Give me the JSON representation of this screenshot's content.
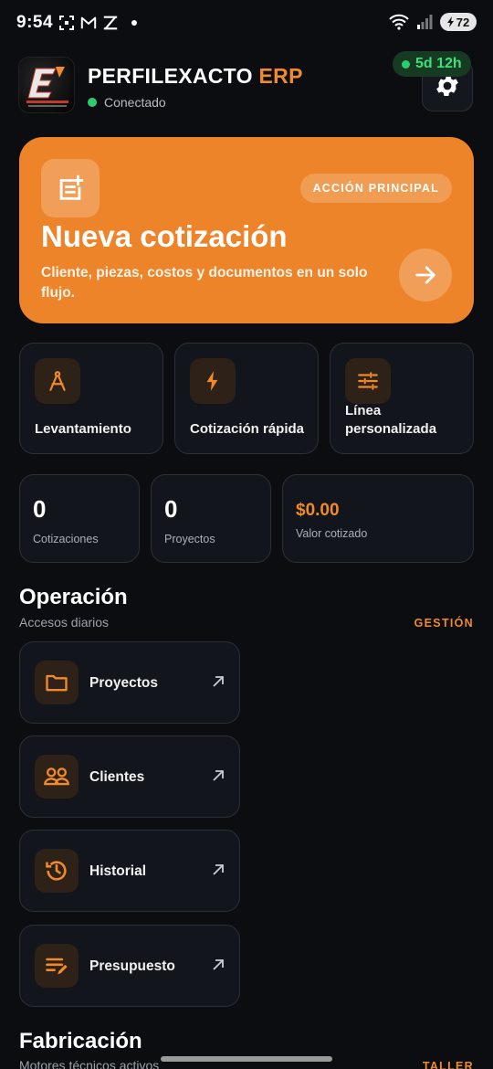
{
  "status_bar": {
    "time": "9:54",
    "battery": "72",
    "icons_left": [
      "scan-icon",
      "gmail-icon",
      "bolt-app-icon",
      "notification-dot"
    ],
    "icons_right": [
      "wifi-icon",
      "signal-icon",
      "battery-icon"
    ]
  },
  "header": {
    "brand_main": "PERFILEXACTO",
    "brand_suffix": "ERP",
    "status": "Conectado",
    "uptime": "5d 12h",
    "settings_icon": "gear-icon"
  },
  "hero": {
    "badge": "ACCIÓN PRINCIPAL",
    "title": "Nueva cotización",
    "subtitle": "Cliente, piezas, costos y documentos en un solo flujo.",
    "icon": "new-document-icon",
    "arrow_icon": "arrow-right-icon"
  },
  "quick_actions": [
    {
      "label": "Levantamiento",
      "icon": "compass-icon"
    },
    {
      "label": "Cotización rápida",
      "icon": "bolt-icon"
    },
    {
      "label": "Línea personalizada",
      "icon": "sliders-icon"
    }
  ],
  "stats": [
    {
      "value": "0",
      "label": "Cotizaciones"
    },
    {
      "value": "0",
      "label": "Proyectos"
    },
    {
      "value": "$0.00",
      "label": "Valor cotizado"
    }
  ],
  "operacion": {
    "title": "Operación",
    "subtitle": "Accesos diarios",
    "link": "GESTIÓN",
    "items": [
      {
        "label": "Proyectos",
        "icon": "folder-icon"
      },
      {
        "label": "Clientes",
        "icon": "users-icon"
      },
      {
        "label": "Historial",
        "icon": "history-icon"
      },
      {
        "label": "Presupuesto",
        "icon": "edit-list-icon"
      }
    ]
  },
  "fabricacion": {
    "title": "Fabricación",
    "subtitle": "Motores técnicos activos",
    "link": "TALLER"
  },
  "colors": {
    "accent": "#ee8429",
    "background": "#0b0d11",
    "card": "#12161c",
    "success": "#2ecc71"
  }
}
